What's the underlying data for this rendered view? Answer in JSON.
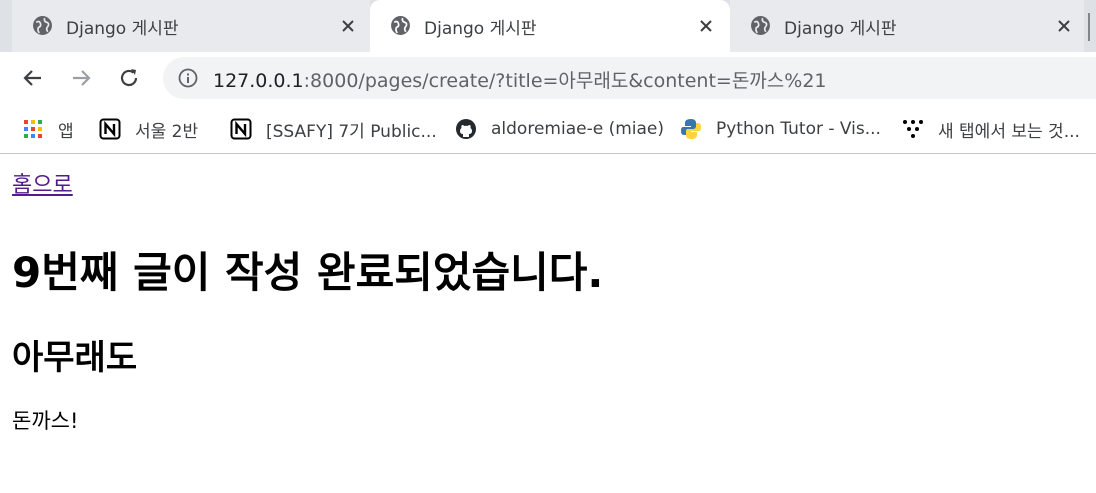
{
  "tabs": [
    {
      "title": "Django 게시판",
      "active": false,
      "favicon": "globe-icon"
    },
    {
      "title": "Django 게시판",
      "active": true,
      "favicon": "globe-icon"
    },
    {
      "title": "Django 게시판",
      "active": false,
      "favicon": "globe-icon"
    }
  ],
  "toolbar": {
    "url_host": "127.0.0.1",
    "url_rest": ":8000/pages/create/?title=아무래도&content=돈까스%21"
  },
  "bookmarks": [
    {
      "label": "앱",
      "icon": "apps-grid-icon"
    },
    {
      "label": "서울 2반",
      "icon": "notion-icon"
    },
    {
      "label": "[SSAFY] 7기 Public...",
      "icon": "notion-icon"
    },
    {
      "label": "aldoremiae-e (miae)",
      "icon": "github-icon"
    },
    {
      "label": "Python Tutor - Vis...",
      "icon": "python-icon"
    },
    {
      "label": "새 탭에서 보는 것...",
      "icon": "dots-tree-icon"
    }
  ],
  "page": {
    "home_link": "홈으로",
    "heading": "9번째 글이 작성 완료되었습니다.",
    "title": "아무래도",
    "content": "돈까스!"
  },
  "colors": {
    "tabstrip_bg": "#dee1e6",
    "omnibox_bg": "#f1f3f4",
    "visited_link": "#551a8b"
  }
}
